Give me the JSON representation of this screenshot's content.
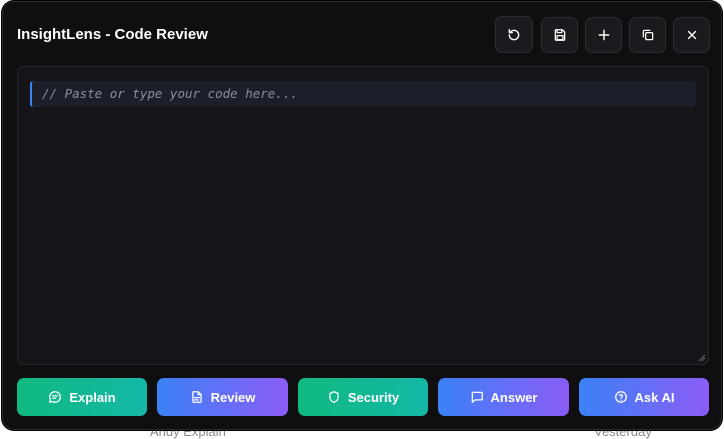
{
  "window": {
    "title": "InsightLens - Code Review"
  },
  "toolbar": {
    "buttons": [
      {
        "icon": "refresh-icon"
      },
      {
        "icon": "save-icon"
      },
      {
        "icon": "plus-icon"
      },
      {
        "icon": "copy-icon"
      },
      {
        "icon": "close-icon"
      }
    ]
  },
  "editor": {
    "placeholder": "// Paste or type your code here..."
  },
  "actions": [
    {
      "label": "Explain",
      "icon": "chat-bubble-icon"
    },
    {
      "label": "Review",
      "icon": "document-icon"
    },
    {
      "label": "Security",
      "icon": "shield-icon"
    },
    {
      "label": "Answer",
      "icon": "message-square-icon"
    },
    {
      "label": "Ask AI",
      "icon": "help-circle-icon"
    }
  ],
  "background": {
    "text_left": "Andy Explain",
    "text_right": "Vesterday"
  },
  "colors": {
    "window_bg": "#0f0f12",
    "editor_bg": "#16161a",
    "accent_blue": "#3b82f6",
    "accent_violet": "#8b5cf6",
    "accent_green": "#10b981",
    "accent_teal": "#14b8a6"
  }
}
